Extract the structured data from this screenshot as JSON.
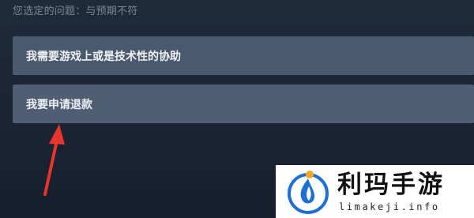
{
  "issue": {
    "selected_text": "您选定的问题：与预期不符"
  },
  "options": [
    {
      "label": "我需要游戏上或是技术性的协助"
    },
    {
      "label": "我要申请退款"
    }
  ],
  "annotation": {
    "arrow_color": "#e8352c"
  },
  "watermark": {
    "title": "利玛手游",
    "url": "limakeji.info",
    "logo_colors": [
      "#1d6fd6",
      "#f5a623"
    ]
  }
}
